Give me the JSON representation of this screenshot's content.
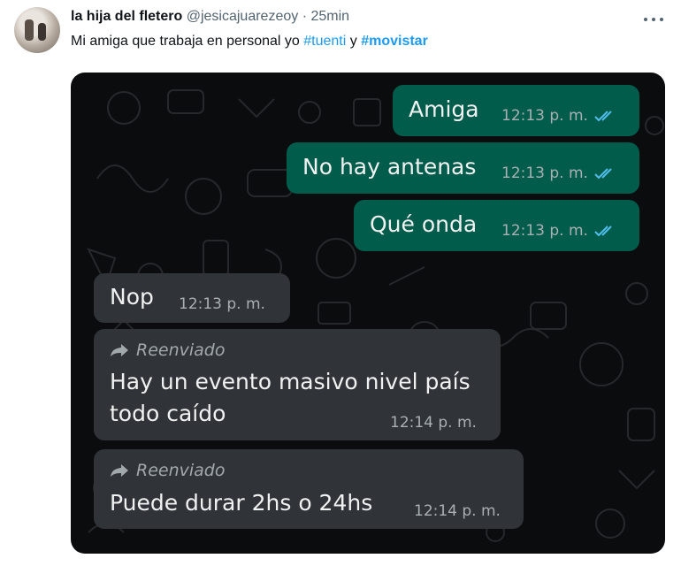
{
  "tweet": {
    "display_name": "la hija del fletero",
    "handle": "@jesicajuarezeoy",
    "separator": "·",
    "time": "25min",
    "text_prefix": "Mi amiga que trabaja en personal yo ",
    "hashtag1": "#tuenti",
    "text_mid": " y ",
    "hashtag2": "#movistar"
  },
  "chat": {
    "messages": [
      {
        "dir": "out",
        "text": "Amiga",
        "time": "12:13 p. m.",
        "read": true
      },
      {
        "dir": "out",
        "text": "No hay antenas",
        "time": "12:13 p. m.",
        "read": true
      },
      {
        "dir": "out",
        "text": "Qué onda",
        "time": "12:13 p. m.",
        "read": true
      },
      {
        "dir": "in",
        "text": "Nop",
        "time": "12:13 p. m."
      },
      {
        "dir": "in",
        "forwarded_label": "Reenviado",
        "line1": "Hay un evento masivo nivel país",
        "line2": "todo caído",
        "time": "12:14 p. m."
      },
      {
        "dir": "in",
        "forwarded_label": "Reenviado",
        "text": "Puede durar 2hs o 24hs",
        "time": "12:14 p. m."
      }
    ]
  },
  "colors": {
    "outgoing_bubble": "#015c4b",
    "incoming_bubble": "#303338",
    "read_ticks": "#53bdeb",
    "hashtag": "#1d9bf0"
  },
  "icons": [
    "more-icon",
    "double-check-icon",
    "forward-arrow-icon"
  ]
}
